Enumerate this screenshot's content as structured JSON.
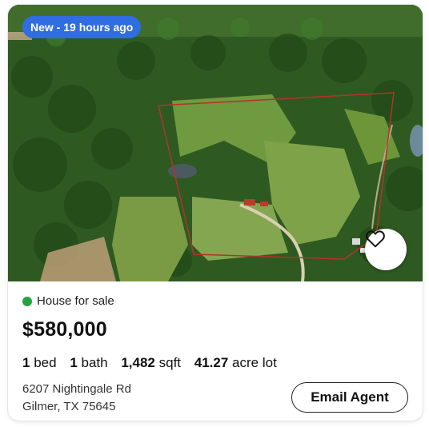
{
  "listing": {
    "badge": "New - 19 hours ago",
    "status": "House for sale",
    "price": "$580,000",
    "beds_count": "1",
    "beds_label": "bed",
    "baths_count": "1",
    "baths_label": "bath",
    "sqft_count": "1,482",
    "sqft_label": "sqft",
    "lot_count": "41.27",
    "lot_label": "acre lot",
    "address_line1": "6207 Nightingale Rd",
    "address_line2": "Gilmer, TX 75645",
    "email_button": "Email Agent"
  },
  "icons": {
    "favorite": "heart-outline-icon",
    "status_dot": "green-dot"
  },
  "colors": {
    "badge_bg": "#2f6de1",
    "status_dot": "#25a244",
    "boundary_line": "#b3332b"
  }
}
